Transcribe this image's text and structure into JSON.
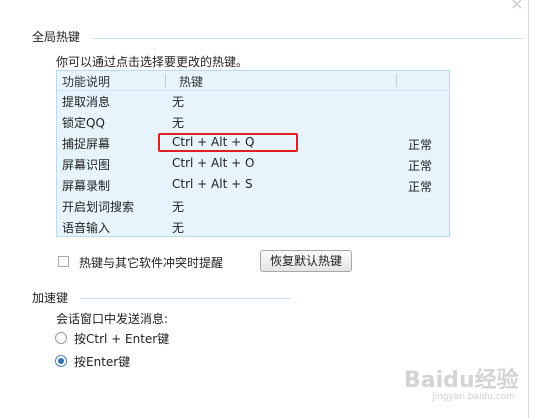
{
  "dialog": {
    "close_glyph": "×"
  },
  "global_hotkeys": {
    "section_title": "全局热键",
    "description": "你可以通过点击选择要更改的热键。",
    "columns": [
      "功能说明",
      "热键"
    ],
    "rows": [
      {
        "function": "提取消息",
        "hotkey": "无",
        "status": ""
      },
      {
        "function": "锁定QQ",
        "hotkey": "无",
        "status": ""
      },
      {
        "function": "捕捉屏幕",
        "hotkey": "Ctrl + Alt + Q",
        "status": "正常"
      },
      {
        "function": "屏幕识图",
        "hotkey": "Ctrl + Alt + O",
        "status": "正常"
      },
      {
        "function": "屏幕录制",
        "hotkey": "Ctrl + Alt + S",
        "status": "正常"
      },
      {
        "function": "开启划词搜索",
        "hotkey": "无",
        "status": ""
      },
      {
        "function": "语音输入",
        "hotkey": "无",
        "status": ""
      }
    ],
    "conflict_checkbox_label": "热键与其它软件冲突时提醒",
    "conflict_checkbox_checked": false,
    "restore_button_label": "恢复默认热键"
  },
  "accelerator": {
    "section_title": "加速键",
    "send_label": "会话窗口中发送消息:",
    "options": [
      {
        "label": "按Ctrl + Enter键",
        "selected": false
      },
      {
        "label": "按Enter键",
        "selected": true
      }
    ]
  },
  "watermark": {
    "main": "Baidu经验",
    "sub": "jingyan.baidu.com"
  },
  "colors": {
    "table_bg": "#e7f4fb",
    "highlight": "#e02020",
    "radio_selected": "#2c6fb5"
  }
}
